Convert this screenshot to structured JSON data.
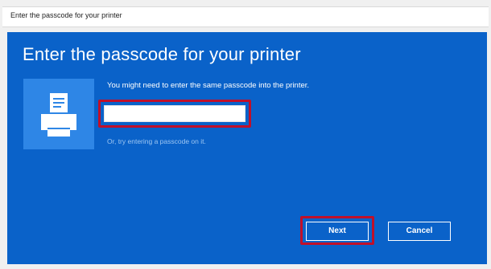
{
  "window": {
    "title": "Enter the passcode for your printer"
  },
  "dialog": {
    "heading": "Enter the passcode for your printer",
    "icon": "printer-icon",
    "instruction": "You might need to enter the same passcode into the printer.",
    "passcode": {
      "value": "",
      "placeholder": ""
    },
    "alt_link": "Or, try entering a passcode on it.",
    "buttons": {
      "next": "Next",
      "cancel": "Cancel"
    }
  },
  "colors": {
    "dialog_background": "#0a62c9",
    "icon_tile": "#2e86e6",
    "highlight": "#c0102a",
    "link": "#9dc6f2"
  }
}
